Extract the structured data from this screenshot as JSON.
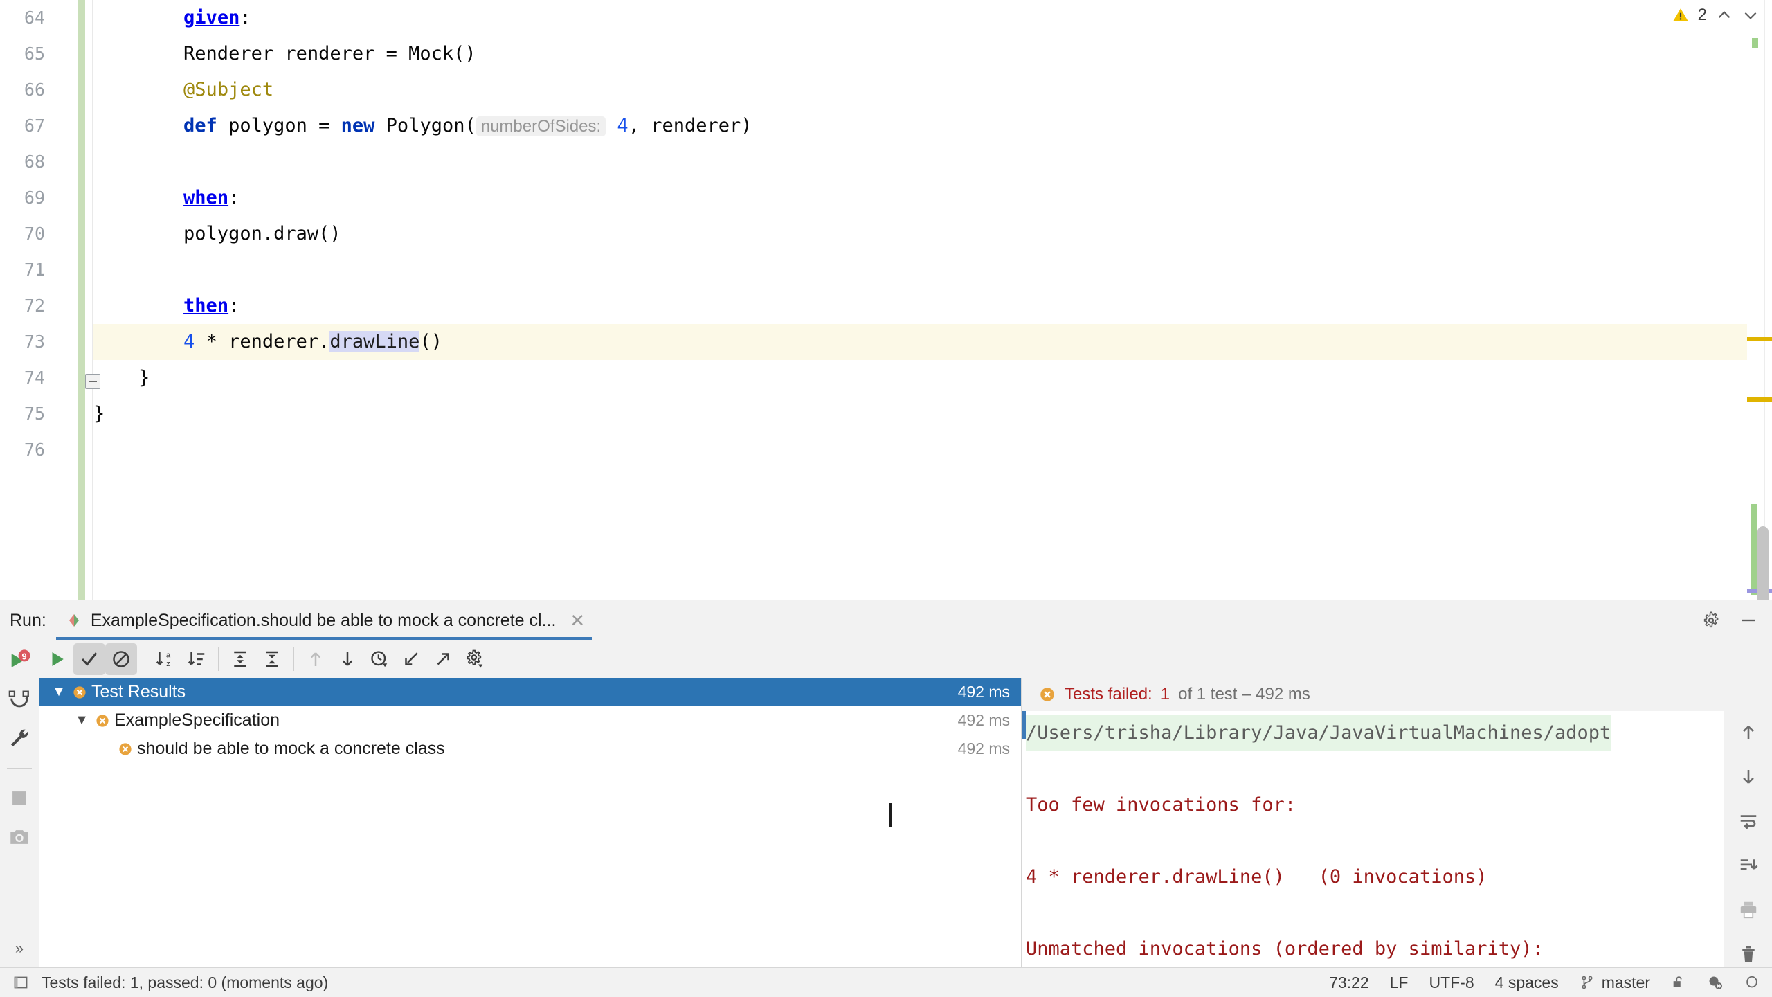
{
  "editor": {
    "first_line_number": 64,
    "lines": [
      {
        "n": 64,
        "tokens": [
          {
            "t": "        ",
            "c": "plain"
          },
          {
            "t": "given",
            "c": "lbl"
          },
          {
            "t": ":",
            "c": "plain"
          }
        ]
      },
      {
        "n": 65,
        "tokens": [
          {
            "t": "        Renderer renderer = Mock()",
            "c": "plain"
          }
        ]
      },
      {
        "n": 66,
        "tokens": [
          {
            "t": "        ",
            "c": "plain"
          },
          {
            "t": "@Subject",
            "c": "ann"
          }
        ]
      },
      {
        "n": 67,
        "tokens": [
          {
            "t": "        ",
            "c": "plain"
          },
          {
            "t": "def",
            "c": "kw"
          },
          {
            "t": " polygon = ",
            "c": "plain"
          },
          {
            "t": "new",
            "c": "kw"
          },
          {
            "t": " Polygon(",
            "c": "plain"
          },
          {
            "t": "numberOfSides:",
            "c": "hint"
          },
          {
            "t": " ",
            "c": "plain"
          },
          {
            "t": "4",
            "c": "num"
          },
          {
            "t": ", renderer)",
            "c": "plain"
          }
        ]
      },
      {
        "n": 68,
        "tokens": []
      },
      {
        "n": 69,
        "tokens": [
          {
            "t": "        ",
            "c": "plain"
          },
          {
            "t": "when",
            "c": "lbl"
          },
          {
            "t": ":",
            "c": "plain"
          }
        ]
      },
      {
        "n": 70,
        "tokens": [
          {
            "t": "        polygon.draw()",
            "c": "plain"
          }
        ]
      },
      {
        "n": 71,
        "tokens": []
      },
      {
        "n": 72,
        "tokens": [
          {
            "t": "        ",
            "c": "plain"
          },
          {
            "t": "then",
            "c": "lbl"
          },
          {
            "t": ":",
            "c": "plain"
          }
        ]
      },
      {
        "n": 73,
        "tokens": [
          {
            "t": "        ",
            "c": "plain"
          },
          {
            "t": "4",
            "c": "num"
          },
          {
            "t": " * renderer.",
            "c": "plain"
          },
          {
            "t": "drawLine",
            "c": "sel-hl"
          },
          {
            "t": "()",
            "c": "plain"
          }
        ]
      },
      {
        "n": 74,
        "tokens": [
          {
            "t": "    }",
            "c": "plain"
          }
        ]
      },
      {
        "n": 75,
        "tokens": [
          {
            "t": "}",
            "c": "plain"
          }
        ]
      },
      {
        "n": 76,
        "tokens": []
      }
    ],
    "highlighted_line": 73,
    "bulb_line": 73,
    "fold_line": 74,
    "inspections": {
      "warning_count": "2",
      "warning_icon": "warning-triangle-icon",
      "up_icon": "chevron-up-icon",
      "down_icon": "chevron-down-icon"
    },
    "colors": {
      "keyword": "#0033b3",
      "label": "#0000ee",
      "annotation": "#9e880d",
      "number": "#1750eb",
      "hint_bg": "#f0f0f0",
      "selection": "#d6d9f5",
      "caret_row": "#fcf9e7",
      "vcs_modified": "#c9dfb9",
      "warning_marker": "#e0b400"
    }
  },
  "run_panel": {
    "label": "Run:",
    "tab_icon": "spock-specification-icon",
    "tab_title": "ExampleSpecification.should be able to mock a concrete cl...",
    "tab_close_icon": "close-icon",
    "header_icons": [
      "settings-gear-icon",
      "minimize-icon"
    ],
    "left_toolbar": [
      {
        "name": "rerun-button",
        "icon": "rerun-icon"
      },
      {
        "name": "rerun-failed-tests-button",
        "icon": "rerun-failed-icon"
      },
      {
        "name": "edit-configuration-button",
        "icon": "wrench-icon"
      },
      {
        "name": "stop-button",
        "icon": "stop-square-icon"
      },
      {
        "name": "dump-threads-button",
        "icon": "camera-icon"
      },
      {
        "name": "expand-toolbar-button",
        "icon": "double-chevron-right-icon"
      }
    ],
    "tests_toolbar": [
      {
        "name": "rerun-tests-button",
        "icon": "play-triangle-icon",
        "pressed": false
      },
      {
        "name": "show-passed-toggle",
        "icon": "checkmark-icon",
        "pressed": true
      },
      {
        "name": "hide-ignored-toggle",
        "icon": "circle-slash-icon",
        "pressed": true
      },
      {
        "name": "sort-alphabetically-button",
        "icon": "sort-az-icon",
        "pressed": false
      },
      {
        "name": "sort-by-duration-button",
        "icon": "sort-duration-icon",
        "pressed": false
      },
      {
        "name": "expand-all-button",
        "icon": "expand-all-icon",
        "pressed": false
      },
      {
        "name": "collapse-all-button",
        "icon": "collapse-all-icon",
        "pressed": false
      },
      {
        "name": "previous-failed-test-button",
        "icon": "arrow-up-icon",
        "pressed": false
      },
      {
        "name": "next-failed-test-button",
        "icon": "arrow-down-icon",
        "pressed": false
      },
      {
        "name": "test-history-button",
        "icon": "clock-history-icon",
        "pressed": false
      },
      {
        "name": "import-tests-button",
        "icon": "import-arrow-icon",
        "pressed": false
      },
      {
        "name": "export-tests-button",
        "icon": "export-arrow-icon",
        "pressed": false
      },
      {
        "name": "test-settings-button",
        "icon": "gear-icon",
        "pressed": false
      }
    ],
    "tree": [
      {
        "label": "Test Results",
        "time": "492 ms",
        "status": "failed",
        "indent": 0,
        "expanded": true,
        "selected": true,
        "has_caret": true
      },
      {
        "label": "ExampleSpecification",
        "time": "492 ms",
        "status": "failed",
        "indent": 1,
        "expanded": true,
        "selected": false,
        "has_caret": true
      },
      {
        "label": "should be able to mock a concrete class",
        "time": "492 ms",
        "status": "failed",
        "indent": 2,
        "expanded": false,
        "selected": false,
        "has_caret": false
      }
    ],
    "console": {
      "status_icon": "failed-circle-icon",
      "status_prefix": "Tests failed:",
      "status_count": "1",
      "status_suffix": "of 1 test – 492 ms",
      "lines": [
        {
          "text": "/Users/trisha/Library/Java/JavaVirtualMachines/adopt",
          "style": "path"
        },
        {
          "text": "",
          "style": "blank"
        },
        {
          "text": "Too few invocations for:",
          "style": "error"
        },
        {
          "text": "",
          "style": "blank"
        },
        {
          "text": "4 * renderer.drawLine()   (0 invocations)",
          "style": "error"
        },
        {
          "text": "",
          "style": "blank"
        },
        {
          "text": "Unmatched invocations (ordered by similarity):",
          "style": "error"
        }
      ],
      "right_toolbar": [
        {
          "name": "scroll-up-button",
          "icon": "arrow-up-icon"
        },
        {
          "name": "scroll-down-button",
          "icon": "arrow-down-icon"
        },
        {
          "name": "soft-wrap-button",
          "icon": "soft-wrap-icon"
        },
        {
          "name": "scroll-to-end-button",
          "icon": "scroll-to-end-icon"
        },
        {
          "name": "print-button",
          "icon": "printer-icon"
        },
        {
          "name": "clear-all-button",
          "icon": "trash-icon"
        }
      ]
    }
  },
  "status_bar": {
    "toggle_icon": "toggle-sidebar-icon",
    "message": "Tests failed: 1, passed: 0 (moments ago)",
    "caret_position": "73:22",
    "line_separator": "LF",
    "encoding": "UTF-8",
    "indent": "4 spaces",
    "branch_icon": "git-branch-icon",
    "branch": "master",
    "lock_icon": "unlocked-padlock-icon",
    "inspections_icon": "inspections-widget-icon",
    "notification_icon": "notification-icon"
  }
}
